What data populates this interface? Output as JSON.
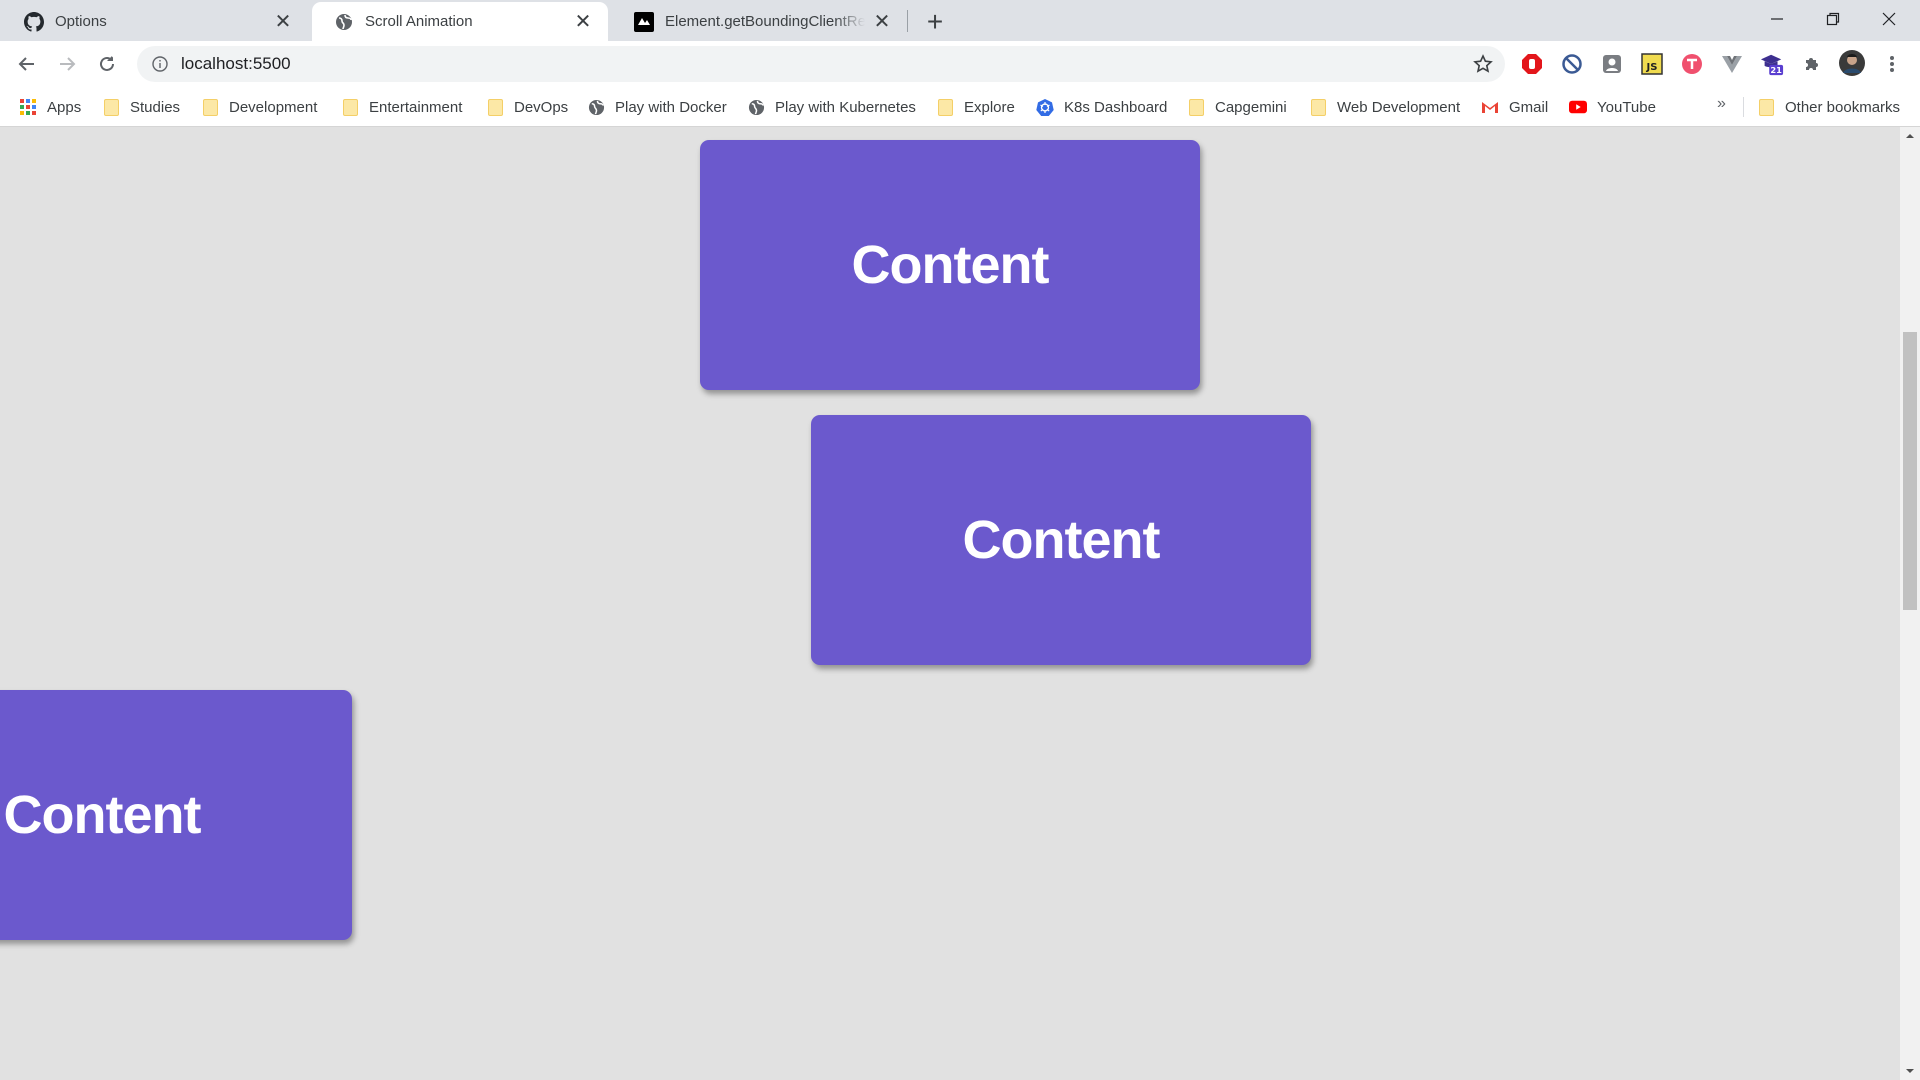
{
  "tabs": [
    {
      "title": "Options",
      "icon": "github-icon",
      "active": false
    },
    {
      "title": "Scroll Animation",
      "icon": "globe-icon",
      "active": true
    },
    {
      "title": "Element.getBoundingClientRect()",
      "icon": "mdn-icon",
      "active": false
    }
  ],
  "toolbar": {
    "url": "localhost:5500"
  },
  "extensions": [
    "adblock-icon",
    "blocker-icon",
    "extension-icon",
    "js-icon",
    "tampermonkey-icon",
    "vue-devtools-icon",
    "graduation-cap-icon",
    "puzzle-icon",
    "profile-avatar"
  ],
  "extension_badge": "21",
  "bookmarks": {
    "items": [
      {
        "label": "Apps",
        "icon": "apps-grid-icon"
      },
      {
        "label": "Studies",
        "icon": "folder-icon"
      },
      {
        "label": "Development",
        "icon": "folder-icon"
      },
      {
        "label": "Entertainment",
        "icon": "folder-icon"
      },
      {
        "label": "DevOps",
        "icon": "folder-icon"
      },
      {
        "label": "Play with Docker",
        "icon": "globe-icon"
      },
      {
        "label": "Play with Kubernetes",
        "icon": "globe-icon"
      },
      {
        "label": "Explore",
        "icon": "folder-icon"
      },
      {
        "label": "K8s Dashboard",
        "icon": "kubernetes-icon"
      },
      {
        "label": "Capgemini",
        "icon": "folder-icon"
      },
      {
        "label": "Web Development",
        "icon": "folder-icon"
      },
      {
        "label": "Gmail",
        "icon": "gmail-icon"
      },
      {
        "label": "YouTube",
        "icon": "youtube-icon"
      }
    ],
    "more": "»",
    "other": "Other bookmarks"
  },
  "page": {
    "boxes": [
      {
        "label": "Content"
      },
      {
        "label": "Content"
      },
      {
        "label": "Content"
      }
    ]
  },
  "colors": {
    "box": "#6b59cd",
    "page_background": "#e1e1e1"
  }
}
